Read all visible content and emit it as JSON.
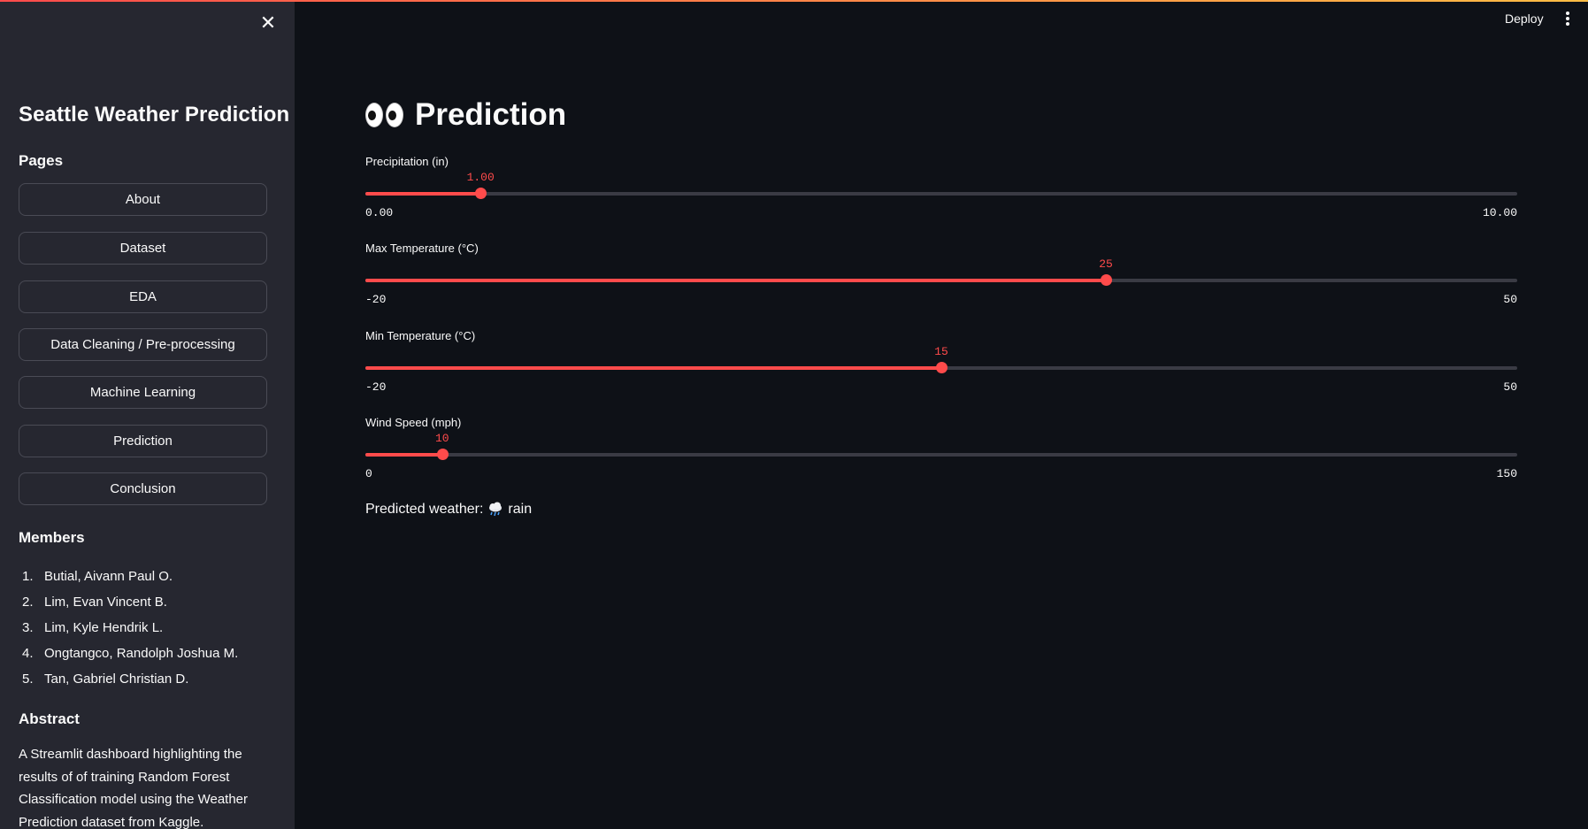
{
  "sidebar": {
    "title": "Seattle Weather Prediction",
    "pages_heading": "Pages",
    "pages": [
      "About",
      "Dataset",
      "EDA",
      "Data Cleaning / Pre-processing",
      "Machine Learning",
      "Prediction",
      "Conclusion"
    ],
    "members_heading": "Members",
    "members": [
      {
        "num": "1.",
        "name": "Butial, Aivann Paul O."
      },
      {
        "num": "2.",
        "name": "Lim, Evan Vincent B."
      },
      {
        "num": "3.",
        "name": "Lim, Kyle Hendrik L."
      },
      {
        "num": "4.",
        "name": "Ongtangco, Randolph Joshua M."
      },
      {
        "num": "5.",
        "name": "Tan, Gabriel Christian D."
      }
    ],
    "abstract_heading": "Abstract",
    "abstract_text": "A Streamlit dashboard highlighting the results of of training Random Forest Classification model using the Weather Prediction dataset from Kaggle.",
    "close_icon": "close-icon"
  },
  "header": {
    "deploy_label": "Deploy",
    "menu_icon": "kebab-menu-icon"
  },
  "main": {
    "title": "Prediction",
    "title_icon": "eyes-emoji-icon",
    "sliders": [
      {
        "label": "Precipitation (in)",
        "value": 1.0,
        "value_text": "1.00",
        "min": 0,
        "max": 10,
        "min_text": "0.00",
        "max_text": "10.00"
      },
      {
        "label": "Max Temperature (°C)",
        "value": 25,
        "value_text": "25",
        "min": -20,
        "max": 50,
        "min_text": "-20",
        "max_text": "50"
      },
      {
        "label": "Min Temperature (°C)",
        "value": 15,
        "value_text": "15",
        "min": -20,
        "max": 50,
        "min_text": "-20",
        "max_text": "50"
      },
      {
        "label": "Wind Speed (mph)",
        "value": 10,
        "value_text": "10",
        "min": 0,
        "max": 150,
        "min_text": "0",
        "max_text": "150"
      }
    ],
    "prediction_label": "Predicted weather:",
    "prediction_icon": "rain-cloud-icon",
    "prediction_value": "rain"
  },
  "colors": {
    "accent": "#ff4b4b",
    "background": "#0e1117",
    "sidebar": "#262730"
  }
}
